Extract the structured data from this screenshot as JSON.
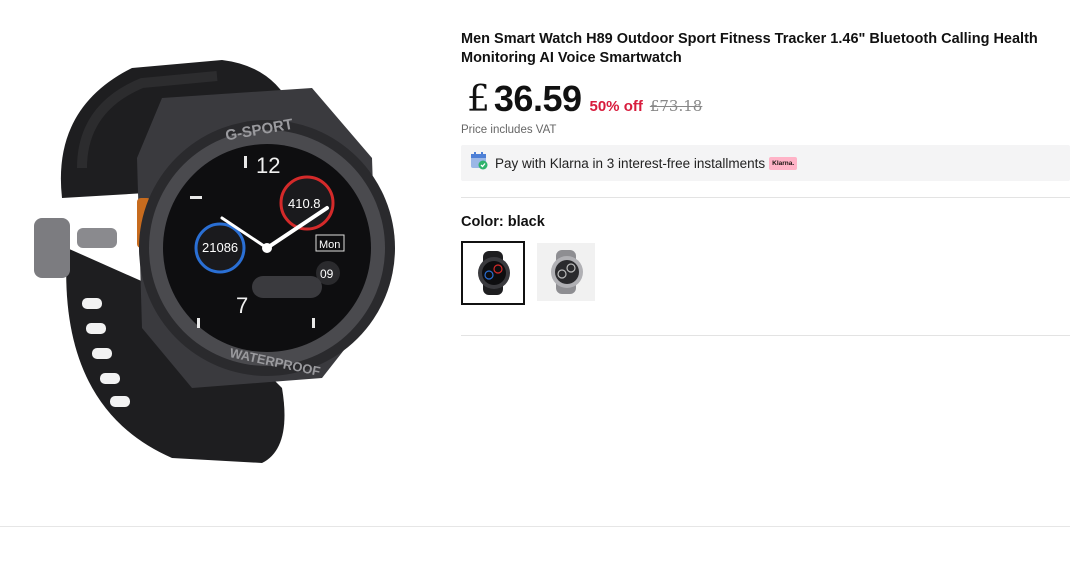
{
  "product": {
    "title": "Men Smart Watch H89 Outdoor Sport Fitness Tracker 1.46\" Bluetooth Calling Health Monitoring AI Voice Smartwatch",
    "image_alt": "Black sport smartwatch with silicone strap",
    "watch_face": {
      "brand_ring_top": "G-SPORT",
      "brand_ring_bottom": "WATERPROOF",
      "hour_12": "12",
      "hour_7": "7",
      "steps": "21086",
      "calories": "410.8",
      "day": "Mon",
      "date": "09"
    }
  },
  "price": {
    "currency_symbol": "£",
    "current": "36.59",
    "discount": "50% off",
    "original": "£73.18",
    "vat_note": "Price includes VAT"
  },
  "klarna": {
    "text": "Pay with Klarna in 3 interest-free installments",
    "badge": "Klarna."
  },
  "color": {
    "label": "Color: black",
    "options": [
      {
        "name": "black",
        "selected": true
      },
      {
        "name": "silver",
        "selected": false
      }
    ]
  },
  "colors": {
    "discount": "#d81b3c",
    "klarna_pink": "#ffb3c7",
    "watch_dark": "#1c1c1e"
  }
}
